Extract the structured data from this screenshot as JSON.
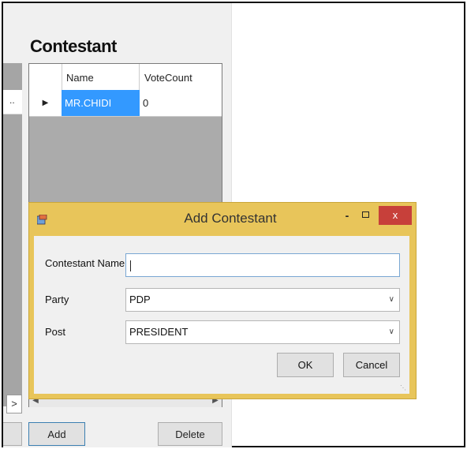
{
  "main": {
    "section_title": "Contestant",
    "grid": {
      "columns": [
        "Name",
        "VoteCount"
      ],
      "rows": [
        {
          "name": "MR.CHIDI",
          "vote_count": "0"
        }
      ]
    },
    "buttons": {
      "add_label": "Add",
      "delete_label": "Delete"
    },
    "left_panel": {
      "row_text": "..",
      "scroll_glyph": ">"
    }
  },
  "dialog": {
    "title": "Add Contestant",
    "title_controls": {
      "minimize": "-",
      "close": "x"
    },
    "labels": {
      "contestant_name": "Contestant Name",
      "party": "Party",
      "post": "Post"
    },
    "fields": {
      "contestant_name_value": ""
    },
    "selects": {
      "party_value": "PDP",
      "post_value": "PRESIDENT"
    },
    "buttons": {
      "ok_label": "OK",
      "cancel_label": "Cancel"
    }
  },
  "colors": {
    "dialog_border": "#e8c55a",
    "selection": "#3399ff",
    "close_button": "#c7403a"
  }
}
